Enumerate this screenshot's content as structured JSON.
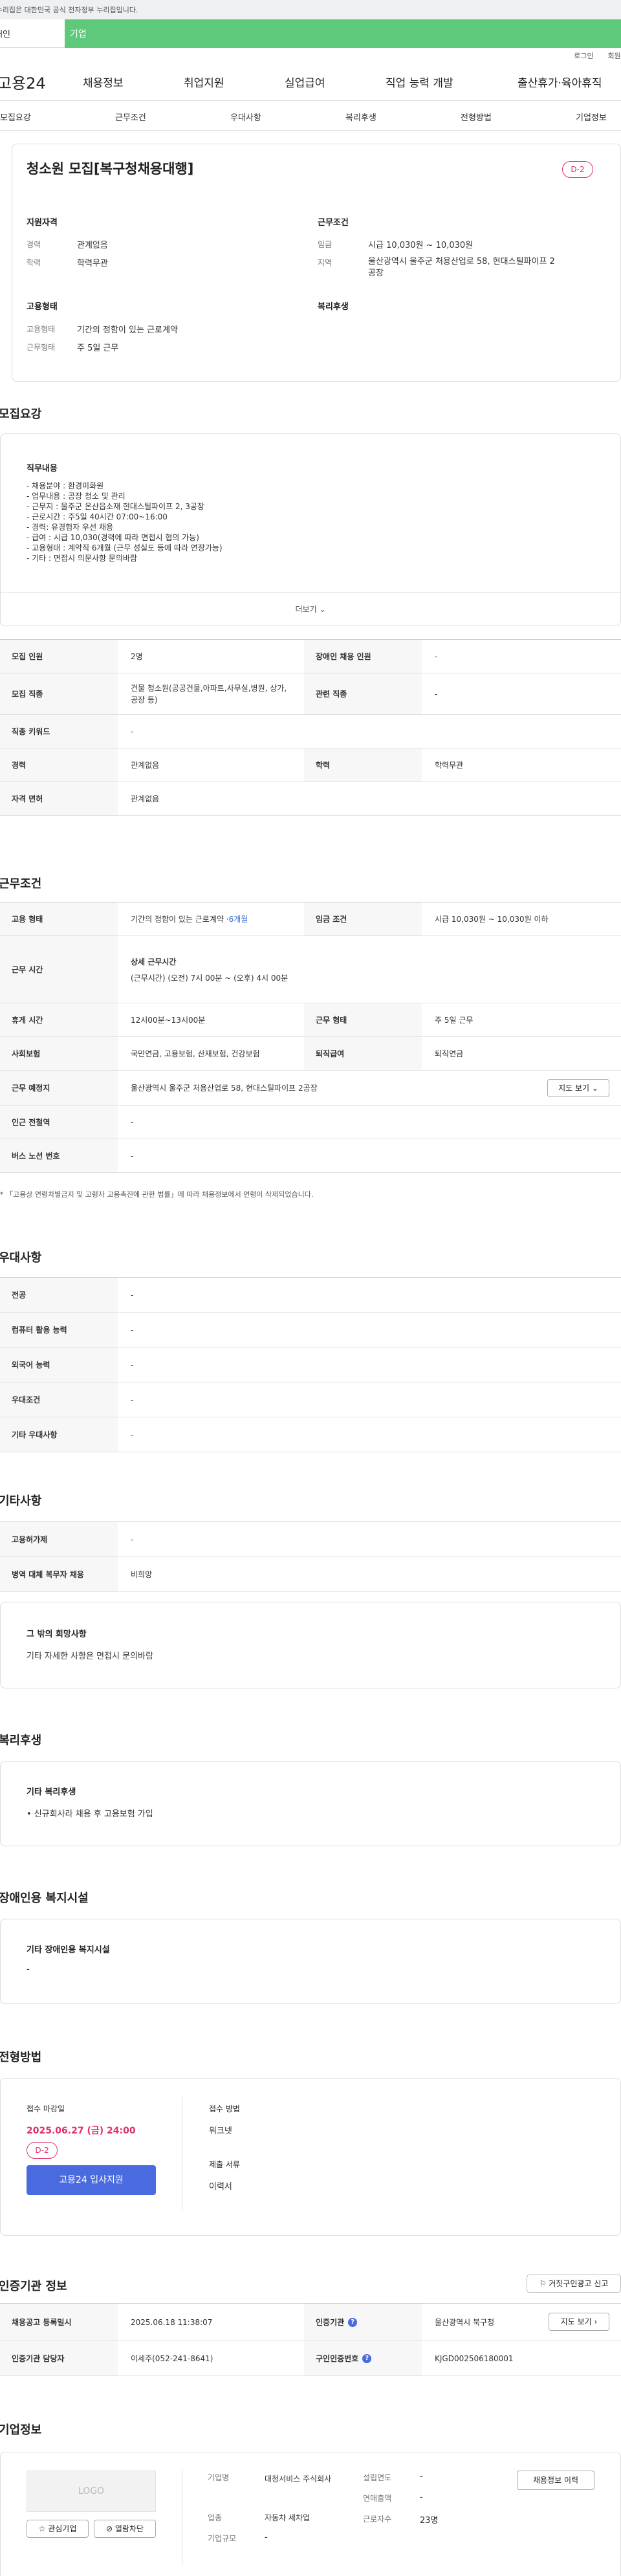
{
  "top": {
    "gov_notice": "이 누리집은 대한민국 공식 전자정부 누리집입니다.",
    "tab_personal": "개인",
    "tab_company": "기업",
    "login": "로그인",
    "join": "회원가입"
  },
  "gnb": {
    "logo": "고용24",
    "m1": "채용정보",
    "m2": "취업지원",
    "m3": "실업급여",
    "m4": "직업 능력 개발",
    "m5": "출산휴가·육아휴직"
  },
  "subnav": [
    "모집요강",
    "근무조건",
    "우대사항",
    "복리후생",
    "전형방법",
    "기업정보"
  ],
  "summary": {
    "title": "청소원 모집[복구청채용대행]",
    "dday": "D-2",
    "qual_title": "지원자격",
    "exp_l": "경력",
    "exp_v": "관계없음",
    "edu_l": "학력",
    "edu_v": "학력무관",
    "work_title": "근무조건",
    "wage_l": "임금",
    "wage_v": "시급 10,030원 ~ 10,030원",
    "loc_l": "지역",
    "loc_v": "울산광역시 울주군 처용산업로 58, 현대스틸파이프 2공장",
    "emp_title": "고용형태",
    "type_l": "고용형태",
    "type_v": "기간의 정함이 있는 근로계약",
    "shape_l": "근무형태",
    "shape_v": "주 5일 근무",
    "welfare_title": "복리후생"
  },
  "recruit": {
    "title": "모집요강",
    "duty_title": "직무내용",
    "duty_lines": [
      "- 채용분야 : 환경미화원",
      "- 업무내용 : 공장 청소 및 관리",
      "- 근무지 : 울주군 온산읍소재 현대스틸파이프 2, 3공장",
      "- 근로시간 : 주5일 40시간 07:00~16:00",
      "- 경력: 유경험자 우선 채용",
      "- 급여 : 시급 10,030(경력에 따라 면접시 협의 가능)",
      "- 고용형태 : 계약직 6개월 (근무 성실도 등에 따라 연장가능)",
      "- 기타 : 면접시 의문사항 문의바람"
    ],
    "more": "더보기",
    "rows": [
      [
        "모집 인원",
        "2명",
        "장애인 채용 인원",
        "-"
      ],
      [
        "모집 직종",
        "건물 청소원(공공건물,아파트,사무실,병원, 상가,공장 등)",
        "관련 직종",
        "-"
      ],
      [
        "직종 키워드",
        "-"
      ],
      [
        "경력",
        "관계없음",
        "학력",
        "학력무관"
      ],
      [
        "자격 면허",
        "관계없음"
      ]
    ]
  },
  "cond": {
    "title": "근무조건",
    "r1": [
      "고용 형태",
      "기간의 정함이 있는 근로계약 · ",
      "6개월",
      "임금 조건",
      "시급 10,030원 ~ 10,030원 이하"
    ],
    "r2": [
      "근무 시간",
      "상세 근무시간",
      "(근무시간) (오전) 7시 00분 ~ (오후) 4시 00분"
    ],
    "r3": [
      "휴게 시간",
      "12시00분~13시00분",
      "근무 형태",
      "주 5일 근무"
    ],
    "r4": [
      "사회보험",
      "국민연금, 고용보험, 산재보험, 건강보험",
      "퇴직급여",
      "퇴직연금"
    ],
    "r5": [
      "근무 예정지",
      "울산광역시 울주군 처용산업로 58, 현대스틸파이프 2공장",
      "지도 보기"
    ],
    "r6": [
      "인근 전철역",
      "-"
    ],
    "r7": [
      "버스 노선 번호",
      "-"
    ],
    "note": "* 「고용상 연령차별금지 및 고령자 고용촉진에 관한 법률」에 따라 채용정보에서 연령이 삭제되었습니다."
  },
  "pref": {
    "title": "우대사항",
    "rows": [
      [
        "전공",
        "-"
      ],
      [
        "컴퓨터 활용 능력",
        "-"
      ],
      [
        "외국어 능력",
        "-"
      ],
      [
        "우대조건",
        "-"
      ],
      [
        "기타 우대사항",
        "-"
      ]
    ]
  },
  "etc": {
    "title": "기타사항",
    "rows": [
      [
        "고용허가제",
        "-"
      ],
      [
        "병역 대체 복무자 채용",
        "비희망"
      ]
    ],
    "hope_title": "그 밖의 희망사항",
    "hope_v": "기타 자세한 사항은 면접시 문의바람"
  },
  "welfare": {
    "title": "복리후생",
    "sub": "기타 복리후생",
    "v": "• 신규회사라 채용 후 고용보험 가입"
  },
  "disab": {
    "title": "장애인용 복지시설",
    "sub": "기타 장애인용 복지시설",
    "v": "-"
  },
  "screen": {
    "title": "전형방법",
    "deadline_l": "접수 마감일",
    "deadline_v": "2025.06.27 (금) 24:00",
    "dday": "D-2",
    "apply": "고용24 입사지원",
    "method_l": "접수 방법",
    "method_v": "워크넷",
    "docs_l": "제출 서류",
    "docs_v": "이력서"
  },
  "cert": {
    "title": "인증기관 정보",
    "report": "거짓구인광고 신고",
    "r1": [
      "채용공고 등록일시",
      "2025.06.18 11:38:07",
      "인증기관",
      "울산광역시 북구청",
      "지도 보기"
    ],
    "r2": [
      "인증기관 담당자",
      "이세주(052-241-8641)",
      "구인인증번호",
      "KJGD002506180001"
    ]
  },
  "company": {
    "title": "기업정보",
    "logo": "LOGO",
    "fav": "관심기업",
    "block": "열람차단",
    "name_l": "기업명",
    "name_v": "대청서비스 주식회사",
    "biz_l": "업종",
    "biz_v": "자동차 세차업",
    "size_l": "기업규모",
    "size_v": "-",
    "year_l": "설립연도",
    "year_v": "-",
    "rev_l": "연매출액",
    "rev_v": "-",
    "emp_l": "근로자수",
    "emp_v": "23명",
    "hist": "채용정보 이력"
  },
  "colors": {
    "accent": "#5ec97a",
    "dday": "#e0306a",
    "button": "#4a6be0"
  }
}
